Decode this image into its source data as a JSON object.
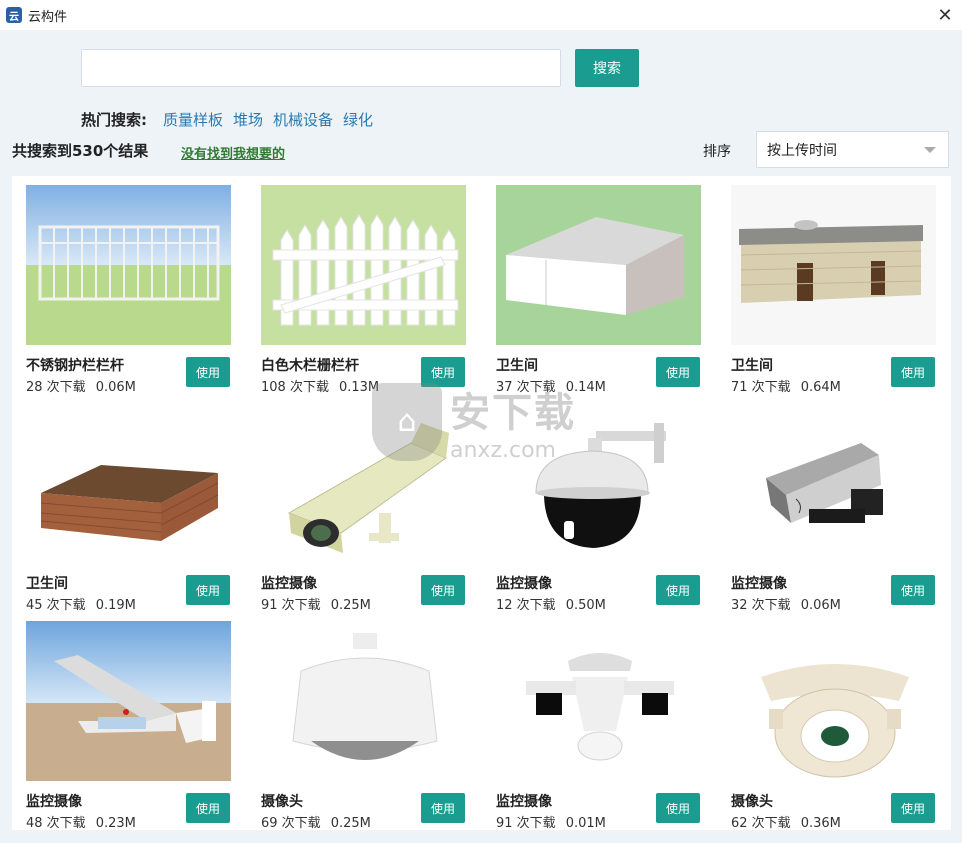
{
  "window": {
    "title": "云构件",
    "app_icon_text": "云"
  },
  "search": {
    "placeholder": "",
    "button_label": "搜索"
  },
  "hot_search": {
    "label": "热门搜索:",
    "items": [
      "质量样板",
      "堆场",
      "机械设备",
      "绿化"
    ]
  },
  "results": {
    "count_text": "共搜索到530个结果",
    "not_found_link": "没有找到我想要的"
  },
  "sort": {
    "label": "排序",
    "selected": "按上传时间"
  },
  "cards": [
    {
      "name": "不锈钢护栏栏杆",
      "downloads": "28 次下载",
      "size": "0.06M",
      "use_label": "使用",
      "thumb": "railing"
    },
    {
      "name": "白色木栏栅栏杆",
      "downloads": "108 次下载",
      "size": "0.13M",
      "use_label": "使用",
      "thumb": "picket-fence"
    },
    {
      "name": "卫生间",
      "downloads": "37 次下载",
      "size": "0.14M",
      "use_label": "使用",
      "thumb": "white-box"
    },
    {
      "name": "卫生间",
      "downloads": "71 次下载",
      "size": "0.64M",
      "use_label": "使用",
      "thumb": "building"
    },
    {
      "name": "卫生间",
      "downloads": "45 次下载",
      "size": "0.19M",
      "use_label": "使用",
      "thumb": "brick-box"
    },
    {
      "name": "监控摄像",
      "downloads": "91 次下载",
      "size": "0.25M",
      "use_label": "使用",
      "thumb": "bullet-camera"
    },
    {
      "name": "监控摄像",
      "downloads": "12 次下载",
      "size": "0.50M",
      "use_label": "使用",
      "thumb": "dome-camera"
    },
    {
      "name": "监控摄像",
      "downloads": "32 次下载",
      "size": "0.06M",
      "use_label": "使用",
      "thumb": "box-camera"
    },
    {
      "name": "监控摄像",
      "downloads": "48 次下载",
      "size": "0.23M",
      "use_label": "使用",
      "thumb": "wall-camera"
    },
    {
      "name": "摄像头",
      "downloads": "69 次下载",
      "size": "0.25M",
      "use_label": "使用",
      "thumb": "pendant-dome"
    },
    {
      "name": "监控摄像",
      "downloads": "91 次下载",
      "size": "0.01M",
      "use_label": "使用",
      "thumb": "dual-camera"
    },
    {
      "name": "摄像头",
      "downloads": "62 次下载",
      "size": "0.36M",
      "use_label": "使用",
      "thumb": "ring-camera"
    }
  ],
  "watermark": {
    "cn": "安下载",
    "en": "anxz.com"
  },
  "colors": {
    "accent": "#1a9c90",
    "link": "#2a7ab0",
    "not_found": "#2f7b32"
  }
}
